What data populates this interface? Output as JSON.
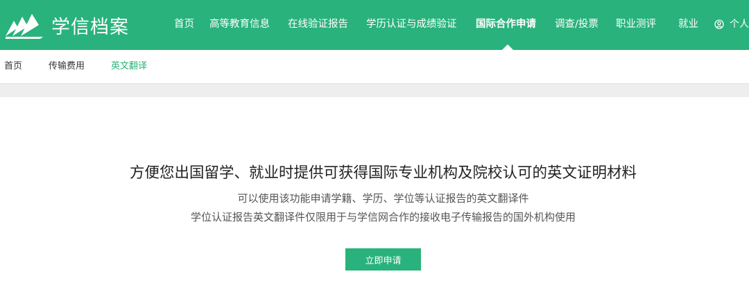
{
  "header": {
    "brand": "学信档案",
    "nav": [
      {
        "label": "首页"
      },
      {
        "label": "高等教育信息"
      },
      {
        "label": "在线验证报告"
      },
      {
        "label": "学历认证与成绩验证"
      },
      {
        "label": "国际合作申请",
        "active": true
      },
      {
        "label": "调查/投票"
      },
      {
        "label": "职业测评"
      },
      {
        "label": "就业"
      }
    ],
    "user_label": "个人("
  },
  "subnav": {
    "items": [
      {
        "label": "首页"
      },
      {
        "label": "传输费用"
      },
      {
        "label": "英文翻译",
        "active": true
      }
    ]
  },
  "hero": {
    "title": "方便您出国留学、就业时提供可获得国际专业机构及院校认可的英文证明材料",
    "line1": "可以使用该功能申请学籍、学历、学位等认证报告的英文翻译件",
    "line2": "学位认证报告英文翻译件仅限用于与学信网合作的接收电子传输报告的国外机构使用",
    "apply_label": "立即申请"
  },
  "colors": {
    "brand_green": "#29b27c",
    "band_gray": "#eeeeee"
  },
  "icons": {
    "logo": "book-pages-logo-icon",
    "user": "user-circle-icon"
  }
}
